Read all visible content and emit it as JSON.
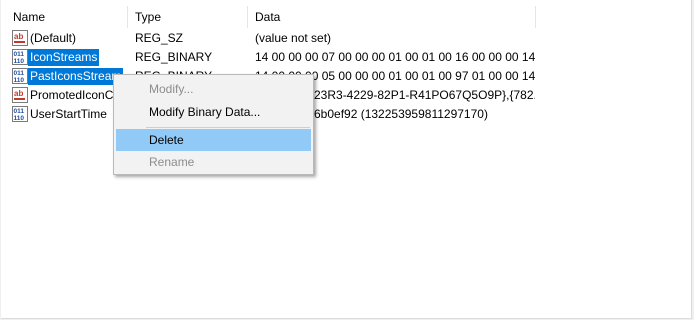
{
  "columns": {
    "name": "Name",
    "type": "Type",
    "data": "Data"
  },
  "rows": [
    {
      "name": "(Default)",
      "type": "REG_SZ",
      "data": "(value not set)",
      "icon": "string-value-icon"
    },
    {
      "name": "IconStreams",
      "type": "REG_BINARY",
      "data": "14 00 00 00 07 00 00 00 01 00 01 00 16 00 00 00 14 00...",
      "icon": "binary-value-icon"
    },
    {
      "name": "PastIconsStream",
      "type": "REG_BINARY",
      "data": "14 00 00 00 05 00 00 00 01 00 01 00 97 01 00 00 14 00...",
      "icon": "binary-value-icon"
    },
    {
      "name": "PromotedIconC",
      "type": "",
      "data": "23R3-4229-82P1-R41PO67Q5O9P},{782...",
      "icon": "string-value-icon"
    },
    {
      "name": "UserStartTime",
      "type": "",
      "data": "6b0ef92 (132253959811297170)",
      "icon": "binary-value-icon"
    }
  ],
  "context_menu": {
    "modify": "Modify...",
    "modify_binary": "Modify Binary Data...",
    "delete": "Delete",
    "rename": "Rename"
  },
  "colors": {
    "selection": "#0078d7",
    "menu_hover": "#91c9f7"
  }
}
